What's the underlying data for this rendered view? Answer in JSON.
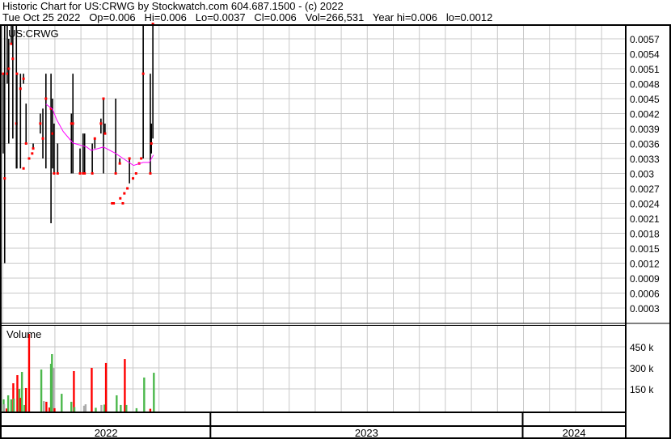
{
  "header": {
    "title": "Historic Chart for US:CRWG by Stockwatch.com 604.687.1500 - (c) 2022",
    "quote": "Tue Oct 25 2022   Op=0.006   Hi=0.006   Lo=0.0037   Cl=0.006   Vol=266,531   Year hi=0.006   lo=0.0012"
  },
  "colors": {
    "up": "#4cb84c",
    "down": "#ff0000",
    "flat": "#aaaaaa",
    "ma": "#ff00ff",
    "grid": "#c8c8c8",
    "tick": "#ff0000"
  },
  "chart_data": {
    "type": "bar",
    "title": "US:CRWG",
    "x_units": "day of 2022",
    "x_range": [
      0,
      1040
    ],
    "years": [
      {
        "label": "2022",
        "start": 0,
        "end": 410
      },
      {
        "label": "2023",
        "start": 410,
        "end": 1023
      },
      {
        "label": "2024",
        "start": 1023,
        "end": 1225
      }
    ],
    "price_axis": {
      "range": [
        0,
        0.006
      ],
      "ticks": [
        "0.0003",
        "0.0006",
        "0.0009",
        "0.0012",
        "0.0015",
        "0.0018",
        "0.0021",
        "0.0024",
        "0.0027",
        "0.003",
        "0.0033",
        "0.0036",
        "0.0039",
        "0.0042",
        "0.0045",
        "0.0048",
        "0.0051",
        "0.0054",
        "0.0057"
      ]
    },
    "price_bars": [
      [
        3,
        0.005,
        0.0034,
        0.005
      ],
      [
        6,
        0.006,
        0.0012,
        0.0029
      ],
      [
        11,
        0.006,
        0.0048,
        0.005
      ],
      [
        14,
        0.0057,
        0.0036,
        0.0051
      ],
      [
        19,
        0.006,
        0.0056,
        0.0056
      ],
      [
        22,
        0.006,
        0.0037,
        0.0053
      ],
      [
        29,
        0.006,
        0.0031,
        0.004
      ],
      [
        30,
        0.005,
        0.0031,
        0.005
      ],
      [
        37,
        0.005,
        0.0031,
        0.0047
      ],
      [
        43,
        0.005,
        0.0048,
        0.0049
      ],
      [
        48,
        0.0044,
        0.0036,
        0.0036
      ],
      [
        62,
        0.0036,
        0.0035,
        0.0035
      ],
      [
        76,
        0.0042,
        0.0038,
        0.004
      ],
      [
        81,
        0.0043,
        0.0033,
        0.0037
      ],
      [
        87,
        0.005,
        0.0031,
        0.0045
      ],
      [
        97,
        0.005,
        0.002,
        0.0043
      ],
      [
        100,
        0.0045,
        0.0031,
        0.0038
      ],
      [
        103,
        0.004,
        0.003,
        0.003
      ],
      [
        110,
        0.0036,
        0.003,
        0.003
      ],
      [
        137,
        0.0042,
        0.003,
        0.004
      ],
      [
        140,
        0.005,
        0.003,
        0.004
      ],
      [
        154,
        0.0035,
        0.003,
        0.003
      ],
      [
        160,
        0.0038,
        0.003,
        0.003
      ],
      [
        163,
        0.0038,
        0.003,
        0.003
      ],
      [
        178,
        0.0036,
        0.003,
        0.003
      ],
      [
        183,
        0.0037,
        0.0035,
        0.0037
      ],
      [
        195,
        0.0041,
        0.0038,
        0.004
      ],
      [
        200,
        0.0045,
        0.003,
        0.0045
      ],
      [
        203,
        0.004,
        0.0038,
        0.0038
      ],
      [
        224,
        0.0045,
        0.003,
        0.003
      ],
      [
        232,
        0.0033,
        0.0032,
        0.0032
      ],
      [
        251,
        0.0033,
        0.0028,
        0.0033
      ],
      [
        278,
        0.006,
        0.0033,
        0.005
      ],
      [
        292,
        0.005,
        0.003,
        0.003
      ],
      [
        294,
        0.004,
        0.0034,
        0.0036
      ],
      [
        297,
        0.006,
        0.0037,
        0.006
      ]
    ],
    "price_points": [
      [
        217,
        0.0024
      ],
      [
        220,
        0.0024
      ],
      [
        233,
        0.0025
      ],
      [
        238,
        0.0024
      ],
      [
        241,
        0.0026
      ],
      [
        247,
        0.0027
      ],
      [
        258,
        0.0029
      ],
      [
        264,
        0.003
      ],
      [
        270,
        0.0032
      ],
      [
        274,
        0.0033
      ],
      [
        60,
        0.0034
      ],
      [
        54,
        0.0033
      ],
      [
        43,
        0.0031
      ]
    ],
    "moving_average": [
      [
        87,
        0.00439
      ],
      [
        100,
        0.00429
      ],
      [
        108,
        0.00408
      ],
      [
        121,
        0.00384
      ],
      [
        140,
        0.00361
      ],
      [
        167,
        0.00353
      ],
      [
        176,
        0.00346
      ],
      [
        200,
        0.00353
      ],
      [
        224,
        0.0034
      ],
      [
        240,
        0.00329
      ],
      [
        259,
        0.00316
      ],
      [
        278,
        0.00322
      ],
      [
        290,
        0.00322
      ],
      [
        298,
        0.00337
      ]
    ],
    "volume_label": "Volume",
    "volume_axis": {
      "range": [
        0,
        600000
      ],
      "ticks": [
        {
          "label": "150 k",
          "value": 150000
        },
        {
          "label": "300 k",
          "value": 300000
        },
        {
          "label": "450 k",
          "value": 450000
        }
      ]
    },
    "volume_bars": [
      [
        2,
        75000,
        "up"
      ],
      [
        3,
        40000,
        "flat"
      ],
      [
        8,
        10000,
        "down"
      ],
      [
        11,
        104000,
        "up"
      ],
      [
        17,
        75000,
        "up"
      ],
      [
        21,
        190000,
        "down"
      ],
      [
        22,
        80000,
        "up"
      ],
      [
        29,
        248000,
        "down"
      ],
      [
        33,
        150000,
        "up"
      ],
      [
        35,
        86000,
        "down"
      ],
      [
        38,
        271000,
        "up"
      ],
      [
        43,
        35000,
        "up"
      ],
      [
        46,
        156000,
        "down"
      ],
      [
        52,
        542000,
        "down"
      ],
      [
        76,
        288000,
        "up"
      ],
      [
        81,
        63000,
        "flat"
      ],
      [
        86,
        58000,
        "down"
      ],
      [
        92,
        17000,
        "down"
      ],
      [
        95,
        329000,
        "up"
      ],
      [
        97,
        398000,
        "up"
      ],
      [
        100,
        300000,
        "flat"
      ],
      [
        102,
        12000,
        "down"
      ],
      [
        116,
        115000,
        "up"
      ],
      [
        135,
        58000,
        "up"
      ],
      [
        140,
        277000,
        "down"
      ],
      [
        141,
        20000,
        "up"
      ],
      [
        160,
        30000,
        "flat"
      ],
      [
        163,
        40000,
        "flat"
      ],
      [
        175,
        300000,
        "down"
      ],
      [
        183,
        15000,
        "up"
      ],
      [
        194,
        35000,
        "flat"
      ],
      [
        200,
        38000,
        "up"
      ],
      [
        203,
        335000,
        "down"
      ],
      [
        224,
        104000,
        "up"
      ],
      [
        232,
        35000,
        "up"
      ],
      [
        240,
        363000,
        "down"
      ],
      [
        243,
        35000,
        "up"
      ],
      [
        263,
        12000,
        "up"
      ],
      [
        278,
        231000,
        "up"
      ],
      [
        290,
        8000,
        "down"
      ],
      [
        297,
        265000,
        "up"
      ]
    ]
  }
}
